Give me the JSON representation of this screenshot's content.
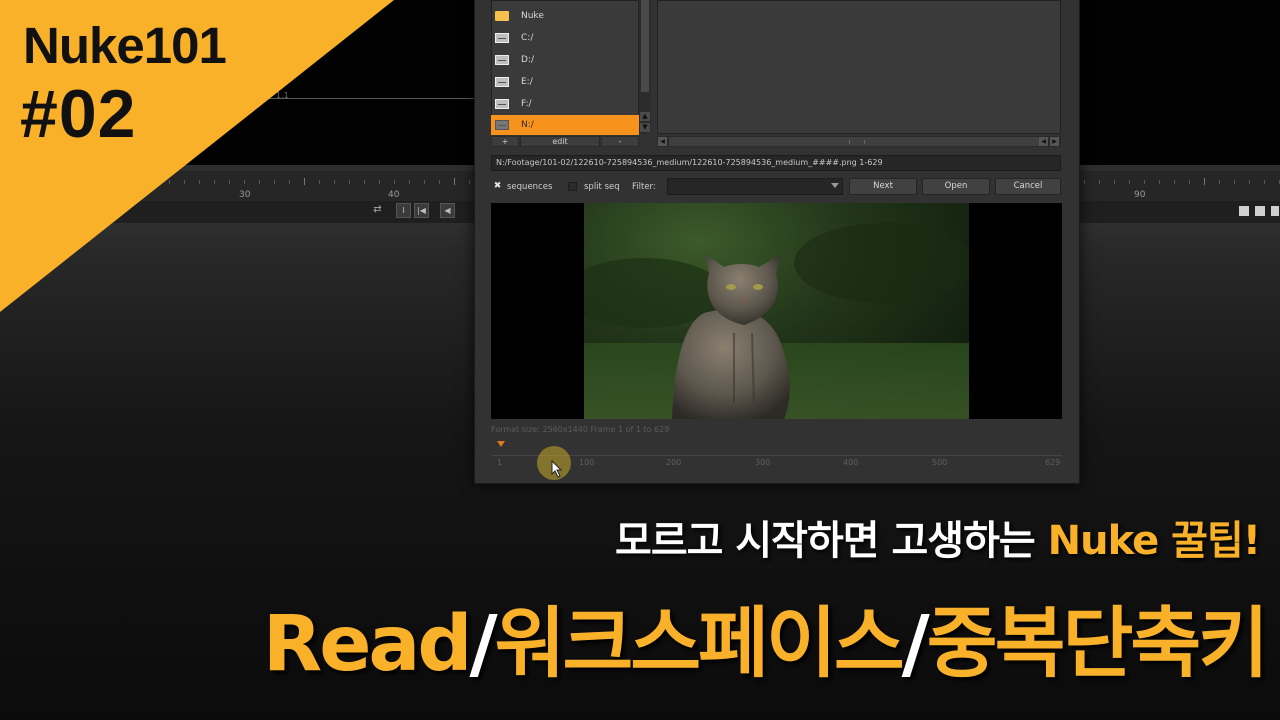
{
  "overlay": {
    "badge_title": "Nuke101",
    "badge_number": "#02",
    "subtitle_prefix": "모르고 시작하면 고생하는 ",
    "subtitle_highlight": "Nuke 꿀팁!",
    "title_part1": "Read",
    "title_sep1": "/",
    "title_part2": "워크스페이스",
    "title_sep2": "/",
    "title_part3": "중복단축키",
    "accent_color": "#f9b12a",
    "text_color": "#ffffff"
  },
  "viewer": {
    "label": "1,1",
    "timeline_labels": [
      "30",
      "40",
      "90"
    ]
  },
  "dialog": {
    "favorites": [
      {
        "label": "Nuke",
        "icon": "folder-icon",
        "selected": false
      },
      {
        "label": "C:/",
        "icon": "drive-icon",
        "selected": false
      },
      {
        "label": "D:/",
        "icon": "drive-icon",
        "selected": false
      },
      {
        "label": "E:/",
        "icon": "drive-icon",
        "selected": false
      },
      {
        "label": "F:/",
        "icon": "drive-icon",
        "selected": false
      },
      {
        "label": "N:/",
        "icon": "drive-icon",
        "selected": true
      }
    ],
    "add_label": "+",
    "edit_label": "edit",
    "remove_label": "-",
    "path": "N:/Footage/101-02/122610-725894536_medium/122610-725894536_medium_####.png 1-629",
    "sequences_label": "sequences",
    "sequences_checked": true,
    "split_seq_label": "split seq",
    "split_seq_checked": false,
    "filter_label": "Filter:",
    "filter_value": "",
    "next_label": "Next",
    "open_label": "Open",
    "cancel_label": "Cancel",
    "format_info": "Format size: 2560x1440   Frame 1 of 1 to 629",
    "frame_labels": [
      "1",
      "100",
      "200",
      "300",
      "400",
      "500",
      "629"
    ],
    "selection_color": "#f7931d"
  }
}
